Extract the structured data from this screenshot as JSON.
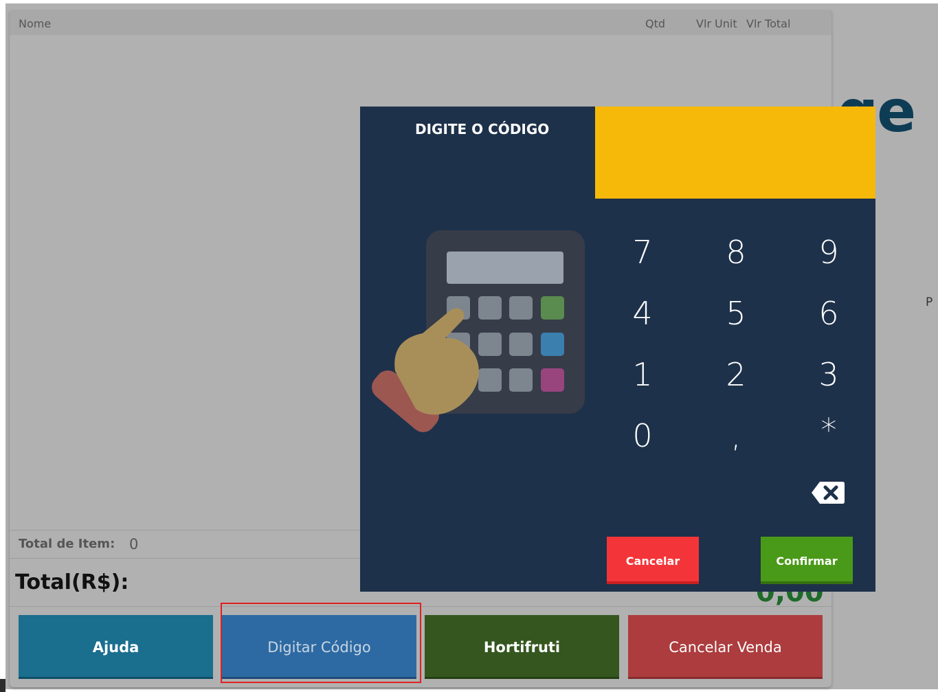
{
  "table": {
    "columns": [
      "Nome",
      "Qtd",
      "Vlr Unit",
      "Vlr Total"
    ]
  },
  "summary": {
    "total_items_label": "Total de Item:",
    "total_items_value": "0",
    "total_label": "Total(R$):",
    "total_value": "0,00"
  },
  "buttons": {
    "ajuda": "Ajuda",
    "digitar_codigo": "Digitar Código",
    "hortifruti": "Hortifruti",
    "cancelar_venda": "Cancelar Venda"
  },
  "side": {
    "logo_fragment": "ge",
    "letter": "P"
  },
  "modal": {
    "title": "DIGITE O CÓDIGO",
    "code_value": "",
    "keys": [
      "7",
      "8",
      "9",
      "4",
      "5",
      "6",
      "1",
      "2",
      "3",
      "0",
      ",",
      "*"
    ],
    "cancel_label": "Cancelar",
    "confirm_label": "Confirmar"
  },
  "colors": {
    "modal_bg": "#1e314a",
    "display_bg": "#f6b90a",
    "cancel": "#f33539",
    "confirm": "#4a9a19",
    "ajuda": "#1a6e8e",
    "digitar": "#2d6aa3",
    "hortifruti": "#35571f",
    "cancelar_venda": "#ad3c3e",
    "highlight": "#e02020"
  },
  "icons": [
    "calculator-hand-illustration",
    "backspace-icon"
  ]
}
